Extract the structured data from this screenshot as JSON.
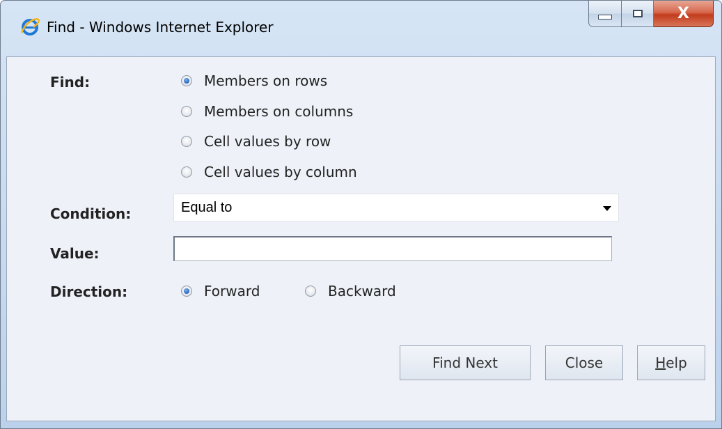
{
  "window": {
    "title": "Find - Windows Internet Explorer",
    "app_icon": "ie-logo-icon",
    "controls": {
      "minimize": "minimize-icon",
      "maximize": "maximize-icon",
      "close_label": "X"
    }
  },
  "find": {
    "label": "Find:",
    "options": [
      {
        "label": "Members on rows",
        "checked": true
      },
      {
        "label": "Members on columns",
        "checked": false
      },
      {
        "label": "Cell values by row",
        "checked": false
      },
      {
        "label": "Cell values by column",
        "checked": false
      }
    ]
  },
  "condition": {
    "label": "Condition:",
    "selected": "Equal to"
  },
  "value": {
    "label": "Value:",
    "current": ""
  },
  "direction": {
    "label": "Direction:",
    "options": [
      {
        "label": "Forward",
        "checked": true
      },
      {
        "label": "Backward",
        "checked": false
      }
    ]
  },
  "buttons": {
    "find_next": "Find Next",
    "close": "Close",
    "help_mnemonic": "H",
    "help_rest": "elp"
  },
  "colors": {
    "title_bg": "#c6d9ef",
    "content_bg": "#eef2f8",
    "close_red": "#c23c1c",
    "radio_selected": "#2e6ec2"
  }
}
